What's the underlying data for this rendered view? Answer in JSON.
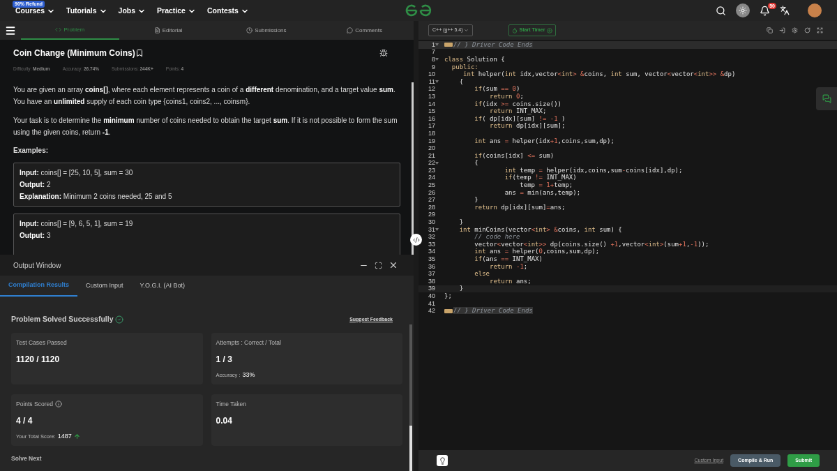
{
  "top_nav": {
    "badge": "90% Refund",
    "menus": [
      "Courses",
      "Tutorials",
      "Jobs",
      "Practice",
      "Contests"
    ],
    "notification_count": "50"
  },
  "problem_tabs": [
    {
      "label": "Problem",
      "selected": true
    },
    {
      "label": "Editorial",
      "selected": false
    },
    {
      "label": "Submissions",
      "selected": false
    },
    {
      "label": "Comments",
      "selected": false
    }
  ],
  "problem": {
    "title": "Coin Change (Minimum Coins)",
    "meta": [
      {
        "label": "Difficulty:",
        "value": "Medium"
      },
      {
        "label": "Accuracy:",
        "value": "26.74%"
      },
      {
        "label": "Submissions:",
        "value": "244K+"
      },
      {
        "label": "Points:",
        "value": "4"
      }
    ],
    "paragraphs": [
      "You are given an array **coins[]**, where each element represents a coin of a **different** denomination, and a target value **sum**. You have an **unlimited** supply of each coin type {coins1, coins2, ..., coinsm}.",
      "Your task is to determine the **minimum** number of coins needed to obtain the target **sum**. If it is not possible to form the sum using the given coins, return **-1**."
    ],
    "examples_heading": "Examples:",
    "examples": [
      {
        "lines": [
          {
            "label": "Input:",
            "value": "coins[] = [25, 10, 5], sum = 30"
          },
          {
            "label": "Output:",
            "value": "2"
          },
          {
            "label": "Explanation:",
            "value": "Minimum 2 coins needed, 25 and 5"
          }
        ]
      },
      {
        "lines": [
          {
            "label": "Input:",
            "value": "coins[] = [9, 6, 5, 1], sum = 19"
          },
          {
            "label": "Output:",
            "value": "3"
          }
        ]
      }
    ]
  },
  "output_window": {
    "title": "Output Window",
    "tabs": [
      {
        "label": "Compilation Results",
        "selected": true
      },
      {
        "label": "Custom Input",
        "selected": false
      },
      {
        "label": "Y.O.G.I. (AI Bot)",
        "selected": false
      }
    ],
    "status": "Problem Solved Successfully",
    "feedback_link": "Suggest Feedback",
    "cards": [
      {
        "kind": "stat",
        "label": "Test Cases Passed",
        "value": "1120 / 1120"
      },
      {
        "kind": "stat",
        "label": "Attempts : Correct / Total",
        "value": "1 / 3",
        "sub_label": "Accuracy :",
        "sub_value": "33%"
      },
      {
        "kind": "points",
        "label": "Points Scored",
        "value": "4 / 4",
        "sub_label": "Your Total Score:",
        "sub_value": "1487"
      },
      {
        "kind": "stat",
        "label": "Time Taken",
        "value": "0.04"
      }
    ],
    "solve_next": "Solve Next"
  },
  "editor": {
    "language": "C++ (g++ 5.4)",
    "timer_button": "Start Timer",
    "lines": [
      {
        "number": "1",
        "kind": "folded",
        "tokens": [
          {
            "kind": "comment",
            "text": "// } Driver Code Ends"
          }
        ]
      },
      {
        "number": "7",
        "kind": "code"
      },
      {
        "number": "8",
        "kind": "fold-start",
        "tokens": [
          {
            "kind": "keyword",
            "text": "class"
          },
          {
            "kind": "text",
            "text": " Solution {"
          }
        ]
      },
      {
        "number": "9",
        "kind": "code",
        "tokens": [
          {
            "kind": "keyword",
            "text": "  public:"
          }
        ]
      },
      {
        "number": "10",
        "kind": "code",
        "tokens": [
          {
            "kind": "keyword",
            "text": "     int"
          },
          {
            "kind": "text",
            "text": " helper("
          },
          {
            "kind": "keyword",
            "text": "int"
          },
          {
            "kind": "text",
            "text": " idx,vector"
          },
          {
            "kind": "operator",
            "text": "<"
          },
          {
            "kind": "keyword",
            "text": "int"
          },
          {
            "kind": "operator",
            "text": ">"
          },
          {
            "kind": "operator",
            "text": " &"
          },
          {
            "kind": "text",
            "text": "coins, "
          },
          {
            "kind": "keyword",
            "text": "int"
          },
          {
            "kind": "text",
            "text": " sum, vector"
          },
          {
            "kind": "operator",
            "text": "<"
          },
          {
            "kind": "text",
            "text": "vector"
          },
          {
            "kind": "operator",
            "text": "<"
          },
          {
            "kind": "keyword",
            "text": "int"
          },
          {
            "kind": "operator",
            "text": ">>"
          },
          {
            "kind": "operator",
            "text": " &"
          },
          {
            "kind": "text",
            "text": "dp)"
          }
        ]
      },
      {
        "number": "11",
        "kind": "fold-start",
        "tokens": [
          {
            "kind": "text",
            "text": "    {"
          }
        ]
      },
      {
        "number": "12",
        "kind": "code",
        "tokens": [
          {
            "kind": "keyword",
            "text": "        if"
          },
          {
            "kind": "text",
            "text": "(sum "
          },
          {
            "kind": "operator",
            "text": "=="
          },
          {
            "kind": "operator",
            "text": " 0"
          },
          {
            "kind": "text",
            "text": ")"
          }
        ]
      },
      {
        "number": "13",
        "kind": "code",
        "tokens": [
          {
            "kind": "keyword",
            "text": "            return"
          },
          {
            "kind": "operator",
            "text": " 0"
          },
          {
            "kind": "text",
            "text": ";"
          }
        ]
      },
      {
        "number": "14",
        "kind": "code",
        "tokens": [
          {
            "kind": "keyword",
            "text": "        if"
          },
          {
            "kind": "text",
            "text": "(idx "
          },
          {
            "kind": "operator",
            "text": ">="
          },
          {
            "kind": "text",
            "text": " coins.size())"
          }
        ]
      },
      {
        "number": "15",
        "kind": "code",
        "tokens": [
          {
            "kind": "keyword",
            "text": "            return"
          },
          {
            "kind": "text",
            "text": " INT_MAX;"
          }
        ]
      },
      {
        "number": "16",
        "kind": "code",
        "tokens": [
          {
            "kind": "keyword",
            "text": "        if"
          },
          {
            "kind": "text",
            "text": "( dp[idx][sum] "
          },
          {
            "kind": "operator",
            "text": "!="
          },
          {
            "kind": "operator",
            "text": " -1"
          },
          {
            "kind": "text",
            "text": " )"
          }
        ]
      },
      {
        "number": "17",
        "kind": "code",
        "tokens": [
          {
            "kind": "keyword",
            "text": "            return"
          },
          {
            "kind": "text",
            "text": " dp[idx][sum];"
          }
        ]
      },
      {
        "number": "18",
        "kind": "code"
      },
      {
        "number": "19",
        "kind": "code",
        "tokens": [
          {
            "kind": "keyword",
            "text": "        int"
          },
          {
            "kind": "text",
            "text": " ans "
          },
          {
            "kind": "operator",
            "text": "="
          },
          {
            "kind": "text",
            "text": " helper(idx"
          },
          {
            "kind": "operator",
            "text": "+1"
          },
          {
            "kind": "text",
            "text": ",coins,sum,dp);"
          }
        ]
      },
      {
        "number": "20",
        "kind": "code"
      },
      {
        "number": "21",
        "kind": "code",
        "tokens": [
          {
            "kind": "keyword",
            "text": "        if"
          },
          {
            "kind": "text",
            "text": "(coins[idx] "
          },
          {
            "kind": "operator",
            "text": "<="
          },
          {
            "kind": "text",
            "text": " sum)"
          }
        ]
      },
      {
        "number": "22",
        "kind": "fold-start",
        "tokens": [
          {
            "kind": "text",
            "text": "        {"
          }
        ]
      },
      {
        "number": "23",
        "kind": "code",
        "tokens": [
          {
            "kind": "keyword",
            "text": "                int"
          },
          {
            "kind": "text",
            "text": " temp "
          },
          {
            "kind": "operator",
            "text": "="
          },
          {
            "kind": "text",
            "text": " helper(idx,coins,sum"
          },
          {
            "kind": "operator",
            "text": "-"
          },
          {
            "kind": "text",
            "text": "coins[idx],dp);"
          }
        ]
      },
      {
        "number": "24",
        "kind": "code",
        "tokens": [
          {
            "kind": "keyword",
            "text": "                if"
          },
          {
            "kind": "text",
            "text": "(temp "
          },
          {
            "kind": "operator",
            "text": "!="
          },
          {
            "kind": "text",
            "text": " INT_MAX)"
          }
        ]
      },
      {
        "number": "25",
        "kind": "code",
        "tokens": [
          {
            "kind": "text",
            "text": "                    temp "
          },
          {
            "kind": "operator",
            "text": "="
          },
          {
            "kind": "operator",
            "text": " 1+"
          },
          {
            "kind": "text",
            "text": "temp;"
          }
        ]
      },
      {
        "number": "26",
        "kind": "code",
        "tokens": [
          {
            "kind": "text",
            "text": "                ans "
          },
          {
            "kind": "operator",
            "text": "="
          },
          {
            "kind": "text",
            "text": " min(ans,temp);"
          }
        ]
      },
      {
        "number": "27",
        "kind": "code",
        "tokens": [
          {
            "kind": "text",
            "text": "        }"
          }
        ]
      },
      {
        "number": "28",
        "kind": "code",
        "tokens": [
          {
            "kind": "keyword",
            "text": "        return"
          },
          {
            "kind": "text",
            "text": " dp[idx][sum]"
          },
          {
            "kind": "operator",
            "text": "="
          },
          {
            "kind": "text",
            "text": "ans;"
          }
        ]
      },
      {
        "number": "29",
        "kind": "code"
      },
      {
        "number": "30",
        "kind": "code",
        "tokens": [
          {
            "kind": "text",
            "text": "    }"
          }
        ]
      },
      {
        "number": "31",
        "kind": "fold-start",
        "tokens": [
          {
            "kind": "keyword",
            "text": "    int"
          },
          {
            "kind": "text",
            "text": " minCoins(vector"
          },
          {
            "kind": "operator",
            "text": "<"
          },
          {
            "kind": "keyword",
            "text": "int"
          },
          {
            "kind": "operator",
            "text": ">"
          },
          {
            "kind": "operator",
            "text": " &"
          },
          {
            "kind": "text",
            "text": "coins, "
          },
          {
            "kind": "keyword",
            "text": "int"
          },
          {
            "kind": "text",
            "text": " sum) {"
          }
        ]
      },
      {
        "number": "32",
        "kind": "code",
        "tokens": [
          {
            "kind": "comment",
            "text": "        // code here"
          }
        ]
      },
      {
        "number": "33",
        "kind": "code",
        "tokens": [
          {
            "kind": "text",
            "text": "        vector"
          },
          {
            "kind": "operator",
            "text": "<"
          },
          {
            "kind": "text",
            "text": "vector"
          },
          {
            "kind": "operator",
            "text": "<"
          },
          {
            "kind": "keyword",
            "text": "int"
          },
          {
            "kind": "operator",
            "text": ">>"
          },
          {
            "kind": "text",
            "text": " dp(coins.size() "
          },
          {
            "kind": "operator",
            "text": "+1"
          },
          {
            "kind": "text",
            "text": ",vector"
          },
          {
            "kind": "operator",
            "text": "<"
          },
          {
            "kind": "keyword",
            "text": "int"
          },
          {
            "kind": "operator",
            "text": ">"
          },
          {
            "kind": "text",
            "text": "(sum"
          },
          {
            "kind": "operator",
            "text": "+1"
          },
          {
            "kind": "text",
            "text": ","
          },
          {
            "kind": "operator",
            "text": "-1"
          },
          {
            "kind": "text",
            "text": "));"
          }
        ]
      },
      {
        "number": "34",
        "kind": "code",
        "tokens": [
          {
            "kind": "keyword",
            "text": "        int"
          },
          {
            "kind": "text",
            "text": " ans "
          },
          {
            "kind": "operator",
            "text": "="
          },
          {
            "kind": "text",
            "text": " helper("
          },
          {
            "kind": "operator",
            "text": "0"
          },
          {
            "kind": "text",
            "text": ",coins,sum,dp);"
          }
        ]
      },
      {
        "number": "35",
        "kind": "code",
        "tokens": [
          {
            "kind": "keyword",
            "text": "        if"
          },
          {
            "kind": "text",
            "text": "(ans "
          },
          {
            "kind": "operator",
            "text": "=="
          },
          {
            "kind": "text",
            "text": " INT_MAX)"
          }
        ]
      },
      {
        "number": "36",
        "kind": "code",
        "tokens": [
          {
            "kind": "keyword",
            "text": "            return"
          },
          {
            "kind": "operator",
            "text": " -1"
          },
          {
            "kind": "text",
            "text": ";"
          }
        ]
      },
      {
        "number": "37",
        "kind": "code",
        "tokens": [
          {
            "kind": "keyword",
            "text": "        else"
          }
        ]
      },
      {
        "number": "38",
        "kind": "code",
        "tokens": [
          {
            "kind": "keyword",
            "text": "            return"
          },
          {
            "kind": "text",
            "text": " ans;"
          }
        ]
      },
      {
        "number": "39",
        "kind": "current",
        "tokens": [
          {
            "kind": "text",
            "text": "    }"
          }
        ]
      },
      {
        "number": "40",
        "kind": "code",
        "tokens": [
          {
            "kind": "text",
            "text": "};"
          }
        ]
      },
      {
        "number": "41",
        "kind": "code"
      },
      {
        "number": "42",
        "kind": "folded",
        "tokens": [
          {
            "kind": "comment",
            "text": "// } Driver Code Ends"
          }
        ]
      }
    ]
  },
  "footer": {
    "custom_input": "Custom Input",
    "compile_button": "Compile & Run",
    "submit_button": "Submit"
  }
}
